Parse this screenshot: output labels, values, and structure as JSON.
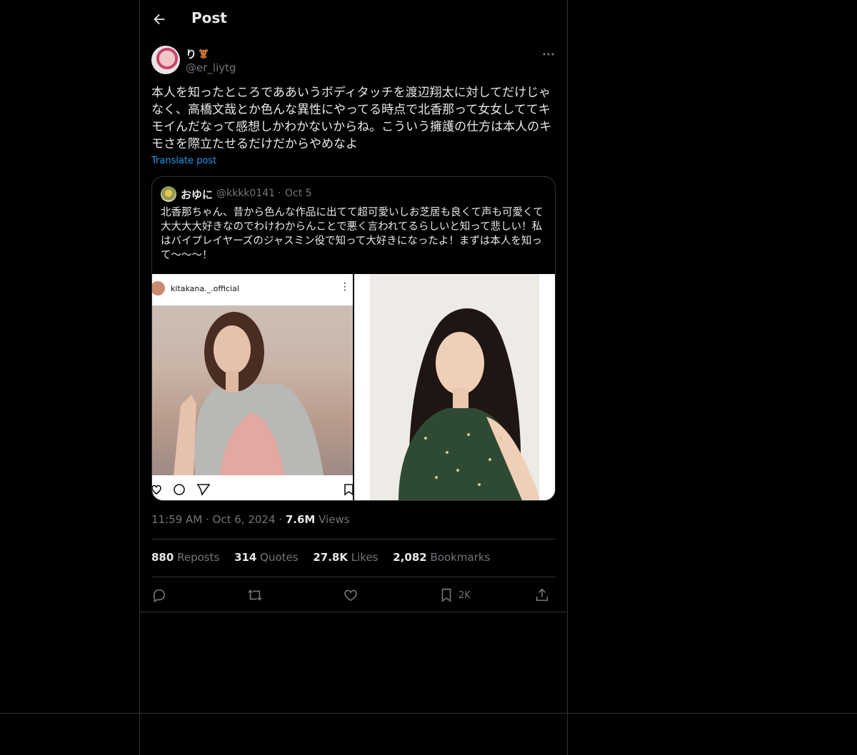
{
  "header": {
    "title": "Post"
  },
  "post": {
    "author_name": "り",
    "author_handle": "@er_liytg",
    "text": "本人を知ったところでああいうボディタッチを渡辺翔太に対してだけじゃなく、高橋文哉とか色んな異性にやってる時点で北香那って女女しててキモイんだなって感想しかわかないからね。こういう擁護の仕方は本人のキモさを際立たせるだけだからやめなよ",
    "translate_label": "Translate post",
    "time": "11:59 AM",
    "date": "Oct 6, 2024",
    "views_count": "7.6M",
    "views_label": "Views"
  },
  "quote": {
    "name": "おゆに",
    "handle": "@kkkk0141",
    "date": "Oct 5",
    "text": "北香那ちゃん、昔から色んな作品に出てて超可愛いしお芝居も良くて声も可愛くて大大大大好きなのでわけわからんことで悪く言われてるらしいと知って悲しい！私はバイプレイヤーズのジャスミン役で知って大好きになったよ！まずは本人を知って〜〜〜！",
    "media_left_username": "kitakana._.official"
  },
  "stats": {
    "reposts_count": "880",
    "reposts_label": "Reposts",
    "quotes_count": "314",
    "quotes_label": "Quotes",
    "likes_count": "27.8K",
    "likes_label": "Likes",
    "bookmarks_count": "2,082",
    "bookmarks_label": "Bookmarks"
  },
  "actions": {
    "bookmark_count": "2K"
  },
  "icons": [
    "back-arrow-icon",
    "more-icon",
    "reply-icon",
    "repost-icon",
    "like-icon",
    "bookmark-icon",
    "share-icon",
    "teddy-bear-emoji"
  ],
  "colors": {
    "background": "#000000",
    "text": "#e7e9ea",
    "muted": "#71767b",
    "accent": "#1d9bf0",
    "border": "#2f3336"
  }
}
